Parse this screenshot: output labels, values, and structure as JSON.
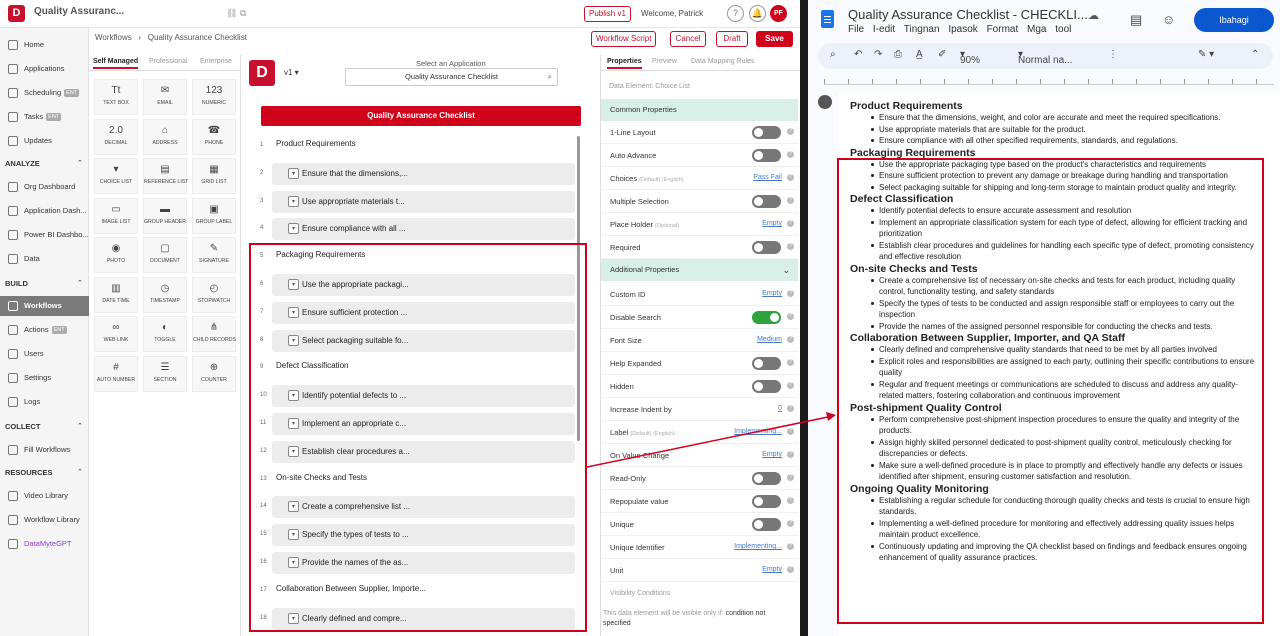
{
  "app": {
    "title": "Quality Assuranc...",
    "publish_label": "Publish v1",
    "welcome": "Welcome, Patrick",
    "notif_count": "99+",
    "avatar_initials": "PF",
    "accent": "#d0021b"
  },
  "sidebar": {
    "items": [
      {
        "label": "Home"
      },
      {
        "label": "Applications"
      },
      {
        "label": "Scheduling",
        "badge": "ENT"
      },
      {
        "label": "Tasks",
        "badge": "ENT"
      },
      {
        "label": "Updates"
      }
    ],
    "analyze_label": "ANALYZE",
    "analyze": [
      {
        "label": "Org Dashboard"
      },
      {
        "label": "Application Dash..."
      },
      {
        "label": "Power BI Dashbo..."
      },
      {
        "label": "Data"
      }
    ],
    "build_label": "BUILD",
    "build": [
      {
        "label": "Workflows"
      },
      {
        "label": "Actions",
        "badge": "ENT"
      },
      {
        "label": "Users"
      },
      {
        "label": "Settings"
      },
      {
        "label": "Logs"
      }
    ],
    "collect_label": "COLLECT",
    "collect": [
      {
        "label": "Fill Workflows"
      }
    ],
    "resources_label": "RESOURCES",
    "resources": [
      {
        "label": "Video Library"
      },
      {
        "label": "Workflow Library"
      },
      {
        "label": "DataMyteGPT"
      }
    ]
  },
  "breadcrumb": {
    "root": "Workflows",
    "sep": "›",
    "current": "Quality Assurance Checklist"
  },
  "actions": {
    "workflow_script": "Workflow Script",
    "cancel": "Cancel",
    "draft": "Draft",
    "save": "Save"
  },
  "toolbox": {
    "tabs": [
      "Self Managed",
      "Professional",
      "Enterprise"
    ],
    "tools": [
      {
        "label": "TEXT BOX",
        "icon": "Tt"
      },
      {
        "label": "EMAIL",
        "icon": "✉"
      },
      {
        "label": "NUMERIC",
        "icon": "123"
      },
      {
        "label": "DECIMAL",
        "icon": "2.0"
      },
      {
        "label": "ADDRESS",
        "icon": "⌂"
      },
      {
        "label": "PHONE",
        "icon": "☎"
      },
      {
        "label": "CHOICE LIST",
        "icon": "▾"
      },
      {
        "label": "REFERENCE LIST",
        "icon": "▤"
      },
      {
        "label": "GRID LIST",
        "icon": "▦"
      },
      {
        "label": "IMAGE LIST",
        "icon": "▭"
      },
      {
        "label": "GROUP HEADER",
        "icon": "▬"
      },
      {
        "label": "GROUP LABEL",
        "icon": "▣"
      },
      {
        "label": "PHOTO",
        "icon": "◉"
      },
      {
        "label": "DOCUMENT",
        "icon": "▢"
      },
      {
        "label": "SIGNATURE",
        "icon": "✎"
      },
      {
        "label": "DATE TIME",
        "icon": "▥"
      },
      {
        "label": "TIMESTAMP",
        "icon": "◷"
      },
      {
        "label": "STOPWATCH",
        "icon": "◴"
      },
      {
        "label": "WEB LINK",
        "icon": "∞"
      },
      {
        "label": "TOGGLE",
        "icon": "◐"
      },
      {
        "label": "CHILD RECORDS",
        "icon": "⋔"
      },
      {
        "label": "AUTO NUMBER",
        "icon": "#"
      },
      {
        "label": "SECTION",
        "icon": "☰"
      },
      {
        "label": "COUNTER",
        "icon": "⊕"
      }
    ]
  },
  "canvas": {
    "version": "v1 ▾",
    "select_app_label": "Select an Application",
    "selected_app": "Quality Assurance Checklist",
    "form_title": "Quality Assurance Checklist",
    "items": [
      {
        "num": "1",
        "type": "section",
        "text": "Product Requirements"
      },
      {
        "num": "2",
        "type": "choice",
        "text": "Ensure that the dimensions,..."
      },
      {
        "num": "3",
        "type": "choice",
        "text": "Use appropriate materials t..."
      },
      {
        "num": "4",
        "type": "choice",
        "text": "Ensure compliance with all ..."
      },
      {
        "num": "5",
        "type": "section",
        "text": "Packaging Requirements"
      },
      {
        "num": "6",
        "type": "choice",
        "text": "Use the appropriate packagi..."
      },
      {
        "num": "7",
        "type": "choice",
        "text": "Ensure sufficient protection ..."
      },
      {
        "num": "8",
        "type": "choice",
        "text": "Select packaging suitable fo..."
      },
      {
        "num": "9",
        "type": "section",
        "text": "Defect Classification"
      },
      {
        "num": "10",
        "type": "choice",
        "text": "Identify potential defects to ..."
      },
      {
        "num": "11",
        "type": "choice",
        "text": "Implement an appropriate c..."
      },
      {
        "num": "12",
        "type": "choice",
        "text": "Establish clear procedures a..."
      },
      {
        "num": "13",
        "type": "section",
        "text": "On-site Checks and Tests"
      },
      {
        "num": "14",
        "type": "choice",
        "text": "Create a comprehensive list ..."
      },
      {
        "num": "15",
        "type": "choice",
        "text": "Specify the types of tests to ..."
      },
      {
        "num": "16",
        "type": "choice",
        "text": "Provide the names of the as..."
      },
      {
        "num": "17",
        "type": "section",
        "text": "Collaboration Between Supplier, Importe..."
      },
      {
        "num": "18",
        "type": "choice",
        "text": "Clearly defined and compre..."
      }
    ]
  },
  "properties": {
    "tabs": [
      "Properties",
      "Preview",
      "Data Mapping Rules"
    ],
    "element_label": "Data Element: Choice List",
    "common_header": "Common Properties",
    "additional_header": "Additional Properties",
    "common": [
      {
        "label": "1-Line Layout",
        "toggle": false
      },
      {
        "label": "Auto Advance",
        "toggle": false
      },
      {
        "label": "Choices",
        "hint": "(Default) (English)",
        "link": "Pass Fail"
      },
      {
        "label": "Multiple Selection",
        "toggle": false
      },
      {
        "label": "Place Holder",
        "hint": "(Optional)",
        "link": "Empty"
      },
      {
        "label": "Required",
        "toggle": false
      }
    ],
    "additional": [
      {
        "label": "Custom ID",
        "link": "Empty"
      },
      {
        "label": "Disable Search",
        "toggle": true
      },
      {
        "label": "Font Size",
        "link": "Medium"
      },
      {
        "label": "Help Expanded",
        "toggle": false
      },
      {
        "label": "Hidden",
        "toggle": false
      },
      {
        "label": "Increase Indent by",
        "link": "0"
      },
      {
        "label": "Label",
        "hint": "(Default) (English)",
        "link": "Implementing..."
      },
      {
        "label": "On Value Change",
        "link": "Empty"
      },
      {
        "label": "Read-Only",
        "toggle": false
      },
      {
        "label": "Repopulate value",
        "toggle": false
      },
      {
        "label": "Unique",
        "toggle": false
      },
      {
        "label": "Unique Identifier",
        "link": "Implementing..."
      },
      {
        "label": "Unit",
        "link": "Empty"
      }
    ],
    "visibility_label": "Visibility Conditions",
    "visibility_note": "This data element will be visible only if:",
    "visibility_value": "condition not specified"
  },
  "gdoc": {
    "title": "Quality Assurance Checklist - CHECKLI...",
    "menu": [
      "File",
      "I-edit",
      "Tingnan",
      "Ipasok",
      "Format",
      "Mga tool"
    ],
    "zoom": "90%",
    "style": "Normal na...",
    "share_label": "Ibahagi",
    "sections": [
      {
        "heading": "Product Requirements",
        "bullets": [
          "Ensure that the dimensions, weight, and color are accurate and meet the required specifications.",
          "Use appropriate materials that are suitable for the product.",
          "Ensure compliance with all other specified requirements, standards, and regulations."
        ]
      },
      {
        "heading": "Packaging Requirements",
        "bullets": [
          "Use the appropriate packaging type based on the product's characteristics and requirements",
          "Ensure sufficient protection to prevent any damage or breakage during handling and transportation",
          "Select packaging suitable for shipping and long-term storage to maintain product quality and integrity."
        ]
      },
      {
        "heading": "Defect Classification",
        "bullets": [
          "Identify potential defects to ensure accurate assessment and resolution",
          "Implement an appropriate classification system for each type of defect, allowing for efficient tracking and prioritization",
          "Establish clear procedures and guidelines for handling each specific type of defect, promoting consistency and effective resolution"
        ]
      },
      {
        "heading": "On-site Checks and Tests",
        "bullets": [
          "Create a comprehensive list of necessary on-site checks and tests for each product, including quality control, functionality testing, and safety standards",
          "Specify the types of tests to be conducted and assign responsible staff or employees to carry out the inspection",
          "Provide the names of the assigned personnel responsible for conducting the checks and tests."
        ]
      },
      {
        "heading": "Collaboration Between Supplier, Importer, and QA Staff",
        "bullets": [
          "Clearly defined and comprehensive quality standards that need to be met by all parties involved",
          "Explicit roles and responsibilities are assigned to each party, outlining their specific contributions to ensure quality",
          "Regular and frequent meetings or communications are scheduled to discuss and address any quality-related matters, fostering collaboration and continuous improvement"
        ]
      },
      {
        "heading": "Post-shipment Quality Control",
        "bullets": [
          "Perform comprehensive post-shipment inspection procedures to ensure the quality and integrity of the products.",
          "Assign highly skilled personnel dedicated to post-shipment quality control, meticulously checking for discrepancies or defects.",
          "Make sure a well-defined procedure is in place to promptly and effectively handle any defects or issues identified after shipment, ensuring customer satisfaction and resolution."
        ]
      },
      {
        "heading": "Ongoing Quality Monitoring",
        "bullets": [
          "Establishing a regular schedule for conducting thorough quality checks and tests is crucial to ensure high standards.",
          "Implementing a well-defined procedure for monitoring and effectively addressing quality issues helps maintain product excellence.",
          "Continuously updating and improving the QA checklist based on findings and feedback ensures ongoing enhancement of quality assurance practices."
        ]
      }
    ]
  }
}
